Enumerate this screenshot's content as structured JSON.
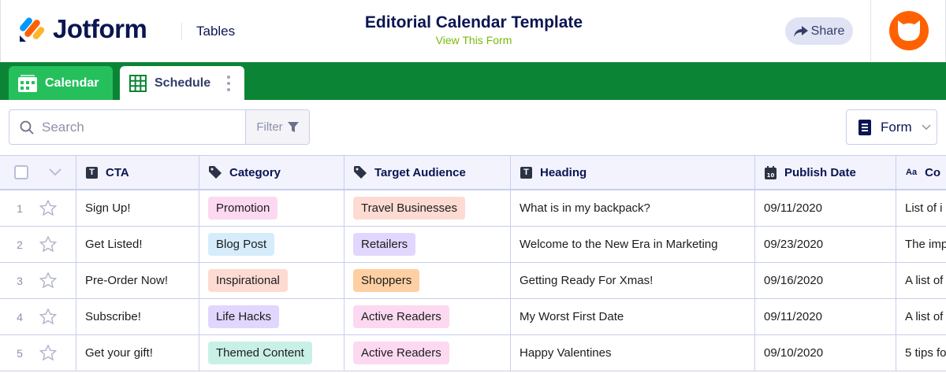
{
  "header": {
    "brand": "Jotform",
    "product": "Tables",
    "title": "Editorial Calendar Template",
    "view_form": "View This Form",
    "share": "Share"
  },
  "tabs": [
    {
      "label": "Calendar",
      "icon": "calendar-icon"
    },
    {
      "label": "Schedule",
      "icon": "grid-icon",
      "active": true
    }
  ],
  "toolbar": {
    "search_placeholder": "Search",
    "filter": "Filter",
    "form": "Form"
  },
  "columns": [
    {
      "label": "CTA",
      "icon": "text-icon"
    },
    {
      "label": "Category",
      "icon": "tag-icon"
    },
    {
      "label": "Target Audience",
      "icon": "tag-icon"
    },
    {
      "label": "Heading",
      "icon": "text-icon"
    },
    {
      "label": "Publish Date",
      "icon": "date-icon"
    },
    {
      "label": "Co",
      "icon": "long-text-icon"
    }
  ],
  "rows": [
    {
      "n": "1",
      "cta": "Sign Up!",
      "category": "Promotion",
      "category_color": "#fcd9f0",
      "audience": "Travel Businesses",
      "audience_color": "#fddbd2",
      "heading": "What is in my backpack?",
      "date": "09/11/2020",
      "content": "List of i"
    },
    {
      "n": "2",
      "cta": "Get Listed!",
      "category": "Blog Post",
      "category_color": "#d5ecfb",
      "audience": "Retailers",
      "audience_color": "#e1d6fd",
      "heading": "Welcome to the New Era in Marketing",
      "date": "09/23/2020",
      "content": "The imp"
    },
    {
      "n": "3",
      "cta": "Pre-Order Now!",
      "category": "Inspirational",
      "category_color": "#fddbd2",
      "audience": "Shoppers",
      "audience_color": "#fdcfa3",
      "heading": "Getting Ready For Xmas!",
      "date": "09/16/2020",
      "content": "A list of"
    },
    {
      "n": "4",
      "cta": "Subscribe!",
      "category": "Life Hacks",
      "category_color": "#e1d6fd",
      "audience": "Active Readers",
      "audience_color": "#fcd9f0",
      "heading": "My Worst First Date",
      "date": "09/11/2020",
      "content": "A list of"
    },
    {
      "n": "5",
      "cta": "Get your gift!",
      "category": "Themed Content",
      "category_color": "#c9f0e6",
      "audience": "Active Readers",
      "audience_color": "#fcd9f0",
      "heading": "Happy Valentines",
      "date": "09/10/2020",
      "content": "5 tips fo"
    }
  ],
  "colors": {
    "green_bar": "#0b8535",
    "tab_calendar": "#25c05c",
    "avatar": "#ff6100",
    "brand_navy": "#0a1551"
  }
}
